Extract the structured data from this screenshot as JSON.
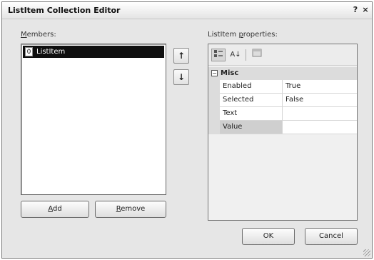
{
  "window": {
    "title": "ListItem Collection Editor",
    "help_label": "?",
    "close_label": "×"
  },
  "members": {
    "label_prefix": "",
    "label_mnemonic": "M",
    "label_rest": "embers:",
    "items": [
      {
        "index": "0",
        "text": "ListItem"
      }
    ]
  },
  "move_buttons": {
    "up_label": "↑",
    "down_label": "↓"
  },
  "buttons": {
    "add_mnemonic": "A",
    "add_rest": "dd",
    "remove_mnemonic": "R",
    "remove_rest": "emove",
    "ok_label": "OK",
    "cancel_label": "Cancel"
  },
  "properties": {
    "label_prefix": "ListItem ",
    "label_mnemonic": "p",
    "label_rest": "roperties:",
    "toolbar": {
      "categorized_icon": "categorized-icon",
      "alphabetical_label": "A↓",
      "property_pages_icon": "property-pages-icon"
    },
    "category": {
      "toggle": "−",
      "name": "Misc"
    },
    "rows": [
      {
        "name": "Enabled",
        "value": "True"
      },
      {
        "name": "Selected",
        "value": "False"
      },
      {
        "name": "Text",
        "value": ""
      },
      {
        "name": "Value",
        "value": ""
      }
    ]
  }
}
